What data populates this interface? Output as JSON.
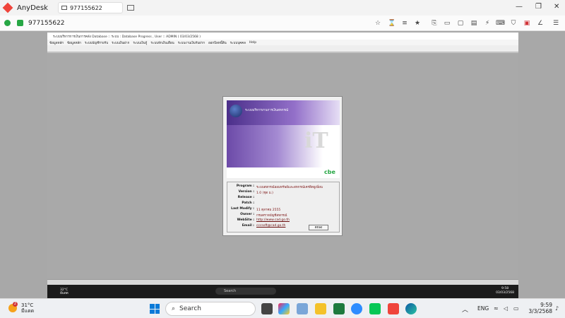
{
  "anydesk": {
    "app_name": "AnyDesk",
    "tab_id": "977155622",
    "address_id": "977155622"
  },
  "remote": {
    "title": "ระบบบริหารการเงินการคลัง Database :: ระบบ : Database Progress , User :: ADMIN ( 03/03/2568 )",
    "menu": [
      "ข้อมูลหลัก",
      "ข้อมูลหลัก",
      "ระบบบัญชีรายรับ",
      "ระบบเงินฝาก",
      "ระบบเงินกู้",
      "ระบบหักเงินเดือน",
      "ระบบงานเงินรับฝาก",
      "ออกบิลหนี้สิน",
      "ระบบบุคคล",
      "Help"
    ],
    "weather": {
      "temp": "32°C",
      "desc": "มีแดด"
    },
    "search_placeholder": "Search",
    "clock": {
      "time": "9:58",
      "date": "03/03/2568"
    }
  },
  "about": {
    "splash_title": "ระบบบริหารงานการเงินสหกรณ์",
    "splash_logo": "cbe",
    "rows": [
      {
        "label": "Program :",
        "value": "ระบบสหกรณ์ออมทรัพย์และสหกรณ์เครดิตยูเนี่ยน"
      },
      {
        "label": "Version :",
        "value": "1.0 (ชุด ม.)"
      },
      {
        "label": "Release :",
        "value": ""
      },
      {
        "label": "Patch :",
        "value": ""
      },
      {
        "label": "Last Modify :",
        "value": "11 ตุลาคม 2555"
      },
      {
        "label": "Owner :",
        "value": "กรมตรวจบัญชีสหกรณ์"
      },
      {
        "label": "WebSite :",
        "value": "http://www.cad.go.th"
      },
      {
        "label": "Email :",
        "value": "cccsoft@cad.go.th"
      }
    ],
    "close_label": "ตกลง"
  },
  "taskbar": {
    "weather": {
      "temp": "31°C",
      "desc": "มีแดด",
      "badge": "2"
    },
    "search_placeholder": "Search",
    "language": "ENG",
    "clock": {
      "time": "9:59",
      "date": "3/3/2568"
    }
  },
  "colors": {
    "anydesk_red": "#ef443b",
    "connected_green": "#27a745",
    "splash_purple": "#6c4aa8"
  }
}
